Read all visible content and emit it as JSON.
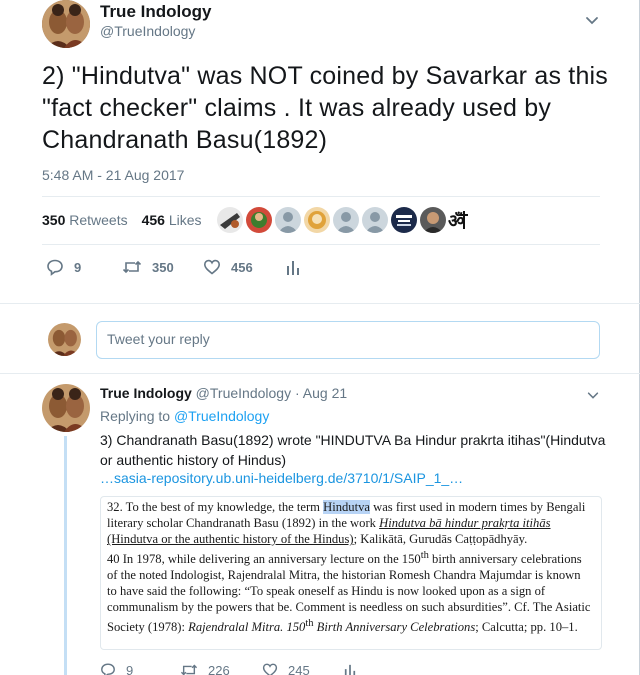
{
  "main_tweet": {
    "author_name": "True Indology",
    "author_handle": "@TrueIndology",
    "text": "2) \"Hindutva\" was NOT coined by Savarkar as this \"fact checker\" claims . It was already used by Chandranath Basu(1892)",
    "timestamp": "5:48 AM - 21 Aug 2017",
    "retweets_count": "350",
    "retweets_label": "Retweets",
    "likes_count": "456",
    "likes_label": "Likes",
    "actions": {
      "replies": "9",
      "retweets": "350",
      "likes": "456"
    }
  },
  "reply_box": {
    "placeholder": "Tweet your reply"
  },
  "reply_tweet": {
    "author_name": "True Indology",
    "author_handle": "@TrueIndology",
    "date": "Aug 21",
    "replying_prefix": "Replying to",
    "replying_to": "@TrueIndology",
    "text": "3) Chandranath Basu(1892) wrote \"HINDUTVA Ba Hindur prakrta itihas\"(Hindutva or authentic history of Hindus)",
    "link": "…sasia-repository.ub.uni-heidelberg.de/3710/1/SAIP_1_…",
    "actions": {
      "replies": "9",
      "retweets": "226",
      "likes": "245"
    }
  },
  "scan": {
    "p1_a": "32. To the best of my knowledge, the term ",
    "p1_hl": "Hindutva",
    "p1_b": " was first used in modern times by Bengali literary scholar Chandranath Basu (1892) in the work ",
    "p1_title": "Hindutva bā hindur prakṛta itihās",
    "p1_c": " (Hindutva or the authentic history of the Hindus)",
    "p1_d": "; Kalikātā, Gurudās Caṭṭopādhyāy.",
    "p2_a": "40  In 1978, while delivering an anniversary lecture on the 150",
    "p2_sup": "th",
    "p2_b": " birth anniversary celebrations of the noted Indologist, Rajendralal Mitra, the historian Romesh Chandra Majumdar is known to have said the following: “To speak oneself as Hindu is now looked upon as a sign of communalism by the powers that be. Comment is needless on such absurdities”. Cf. The Asiatic Society (1978): ",
    "p2_title": "Rajendralal Mitra. 150",
    "p2_sup2": "th",
    "p2_title2": " Birth Anniversary Celebrations",
    "p2_c": "; Calcutta; pp. 10–1."
  },
  "colors": {
    "accent": "#1da1f2",
    "text": "#14171a",
    "muted": "#657786",
    "thread": "#c4dff5"
  },
  "icons": [
    "chevron-down-icon",
    "reply-icon",
    "retweet-icon",
    "heart-icon",
    "analytics-icon"
  ]
}
